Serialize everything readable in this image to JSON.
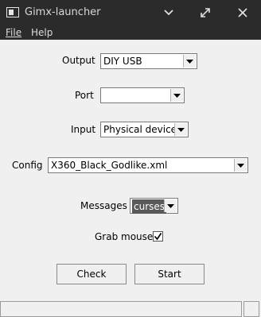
{
  "window": {
    "title": "Gimx-launcher",
    "icons": {
      "app": "app-window-icon",
      "minimize": "chevron-down-icon",
      "maximize": "expand-icon",
      "close": "close-icon"
    }
  },
  "menubar": {
    "file": "File",
    "help": "Help",
    "file_mnemonic": "F",
    "help_mnemonic": "H"
  },
  "form": {
    "output_label": "Output",
    "output_value": "DIY USB",
    "port_label": "Port",
    "port_value": "",
    "input_label": "Input",
    "input_value": "Physical devices",
    "config_label": "Config",
    "config_value": "X360_Black_Godlike.xml",
    "messages_label": "Messages",
    "messages_value": "curses",
    "grab_mouse_label": "Grab mouse",
    "grab_mouse_checked": true
  },
  "buttons": {
    "check": "Check",
    "start": "Start"
  },
  "colors": {
    "titlebar_bg": "#2b2b2b",
    "window_bg": "#f0f0f0",
    "selected_value_bg": "#5a5a5a"
  }
}
